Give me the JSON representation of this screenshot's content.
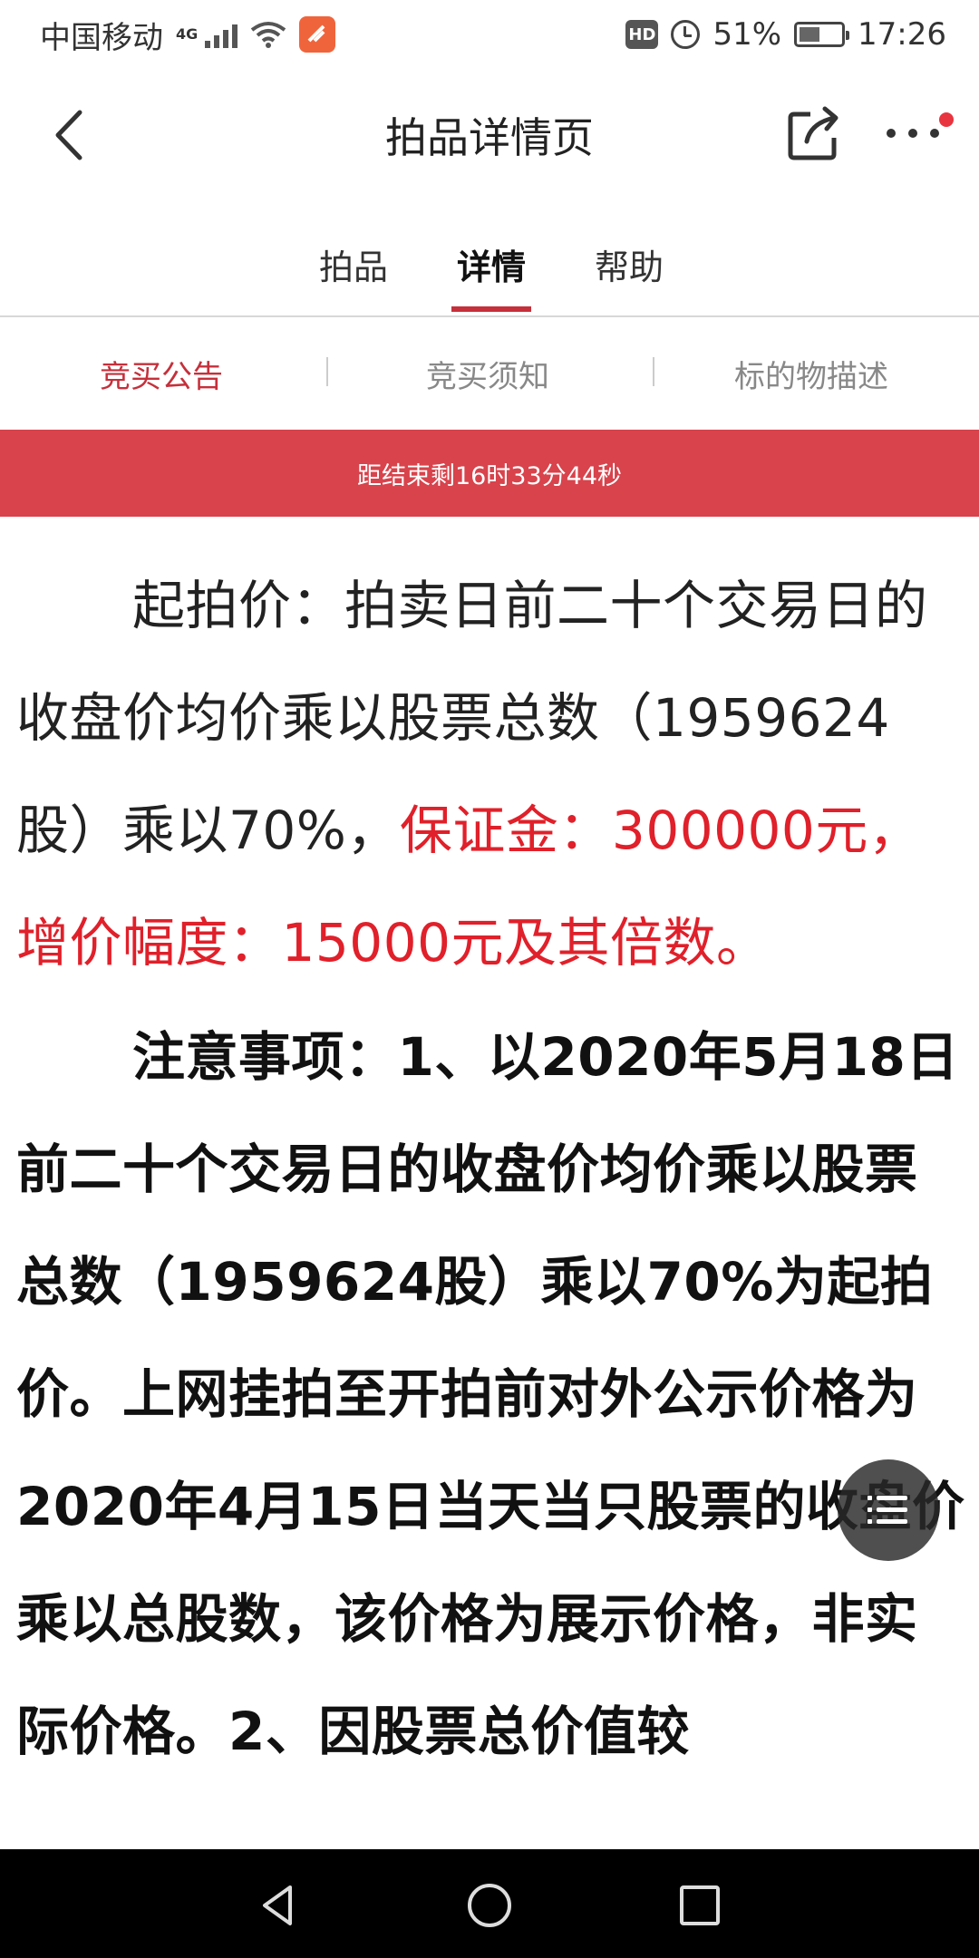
{
  "status_bar": {
    "carrier": "中国移动",
    "network": "4G",
    "battery_percent": "51%",
    "battery_level": 0.51,
    "time": "17:26",
    "hd_label": "HD",
    "icons": [
      "signal-icon",
      "wifi-icon",
      "app-notification-icon",
      "hd-icon",
      "alarm-icon",
      "battery-icon"
    ]
  },
  "header": {
    "title": "拍品详情页",
    "back_icon": "chevron-left-icon",
    "share_icon": "share-icon",
    "more_icon": "more-dots-icon",
    "notification_dot_color": "#e8343f"
  },
  "tabs": [
    {
      "label": "拍品",
      "active": false
    },
    {
      "label": "详情",
      "active": true
    },
    {
      "label": "帮助",
      "active": false
    }
  ],
  "subtabs": [
    {
      "label": "竞买公告",
      "active": true
    },
    {
      "label": "竞买须知",
      "active": false
    },
    {
      "label": "标的物描述",
      "active": false
    }
  ],
  "countdown": {
    "text": "距结束剩16时33分44秒"
  },
  "content": {
    "para1": {
      "normal": "起拍价：拍卖日前二十个交易日的收盘价均价乘以股票总数（1959624股）乘以70%，",
      "highlight": "保证金：300000元，增价幅度：15000元及其倍数。"
    },
    "para2": "注意事项：1、以2020年5月18日前二十个交易日的收盘价均价乘以股票总数（1959624股）乘以70%为起拍价。上网挂拍至开拍前对外公示价格为2020年4月15日当天当只股票的收盘价乘以总股数，该价格为展示价格，非实际价格。2、因股票总价值较"
  },
  "floating_button": {
    "icon": "menu-list-icon"
  },
  "nav_bar": {
    "icons": [
      "back-triangle-icon",
      "home-circle-icon",
      "recents-square-icon"
    ]
  },
  "colors": {
    "accent": "#c5303b",
    "banner": "#d8434c",
    "highlight_text": "#e0202a"
  }
}
